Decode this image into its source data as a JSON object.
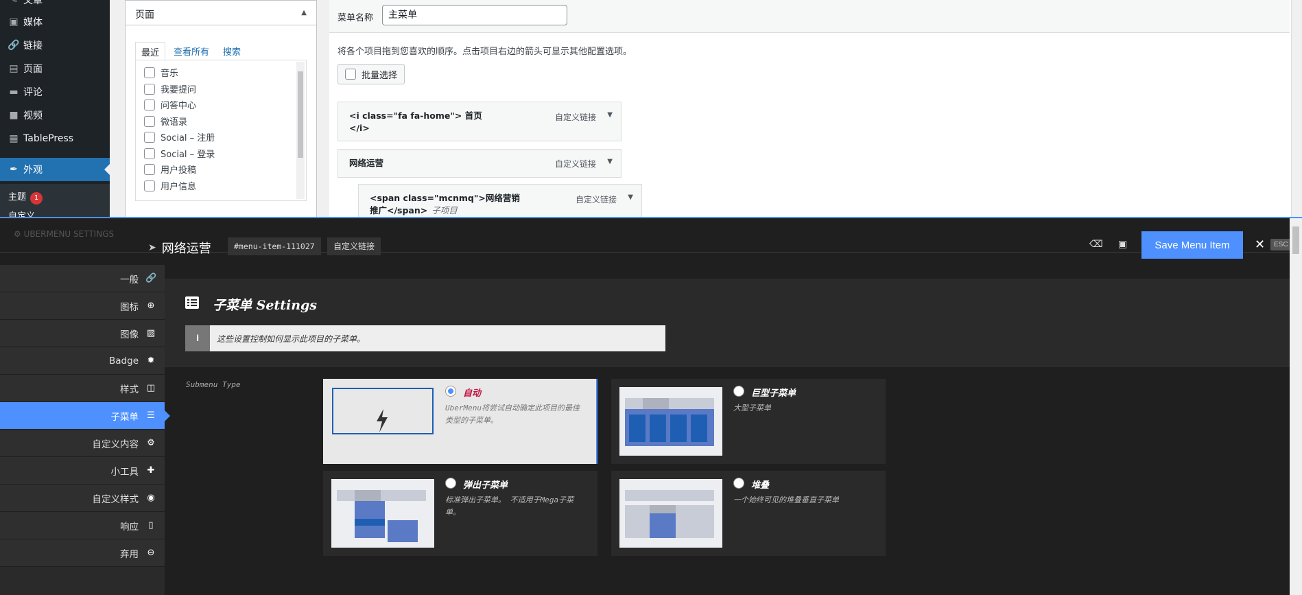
{
  "wp": {
    "sidebar": [
      {
        "icon": "✎",
        "label": "文章"
      },
      {
        "icon": "▣",
        "label": "媒体"
      },
      {
        "icon": "🔗",
        "label": "链接"
      },
      {
        "icon": "▤",
        "label": "页面"
      },
      {
        "icon": "▬",
        "label": "评论"
      },
      {
        "icon": "■",
        "label": "视频"
      },
      {
        "icon": "▦",
        "label": "TablePress"
      },
      {
        "icon": "✒",
        "label": "外观"
      }
    ],
    "submenu": {
      "theme_label": "主题",
      "theme_badge": "1",
      "customize_label": "自定义"
    },
    "pages_box": {
      "title": "页面",
      "tabs": [
        "最近",
        "查看所有",
        "搜索"
      ],
      "items": [
        "音乐",
        "我要提问",
        "问答中心",
        "微语录",
        "Social – 注册",
        "Social – 登录",
        "用户投稿",
        "用户信息"
      ]
    },
    "menu": {
      "name_label": "菜单名称",
      "name_value": "主菜单",
      "instructions": "将各个项目拖到您喜欢的顺序。点击项目右边的箭头可显示其他配置选项。",
      "bulk_select": "批量选择",
      "items": [
        {
          "title_l1": "<i class=\"fa fa-home\"> 首页",
          "title_l2": "</i>",
          "type": "自定义链接"
        },
        {
          "title_l1": "网络运营",
          "title_l2": "",
          "type": "自定义链接"
        },
        {
          "title_l1": "<span class=\"mcnmq\">网络营销",
          "title_l2": "推广</span>",
          "sub": "子项目",
          "type": "自定义链接"
        }
      ]
    }
  },
  "uber": {
    "brand": "UBERMENU SETTINGS",
    "item_title": "网络运营",
    "item_id": "#menu-item-111027",
    "item_type": "自定义链接",
    "save_label": "Save Menu Item",
    "esc_label": "ESC",
    "nav": [
      {
        "label": "一般",
        "icon": "🔗"
      },
      {
        "label": "图标",
        "icon": "⊕"
      },
      {
        "label": "图像",
        "icon": "▨"
      },
      {
        "label": "Badge",
        "icon": "✹"
      },
      {
        "label": "样式",
        "icon": "◫"
      },
      {
        "label": "子菜单",
        "icon": "☰"
      },
      {
        "label": "自定义内容",
        "icon": "⚙"
      },
      {
        "label": "小工具",
        "icon": "✚"
      },
      {
        "label": "自定义样式",
        "icon": "◉"
      },
      {
        "label": "响应",
        "icon": "▯"
      },
      {
        "label": "弃用",
        "icon": "⊖"
      }
    ],
    "active_nav_index": 5,
    "settings_title": "子菜单 Settings",
    "settings_info": "这些设置控制如何显示此项目的子菜单。",
    "submenu_type_label": "Submenu Type",
    "options": [
      {
        "name": "自动",
        "desc": "UberMenu将尝试自动确定此项目的最佳类型的子菜单。",
        "selected": true
      },
      {
        "name": "巨型子菜单",
        "desc": "大型子菜单",
        "selected": false
      },
      {
        "name": "弹出子菜单",
        "desc": "标准弹出子菜单。 不适用于Mega子菜单。",
        "selected": false
      },
      {
        "name": "堆叠",
        "desc": "一个始终可见的堆叠垂直子菜单",
        "selected": false
      }
    ],
    "colors": {
      "accent": "#4d90fe",
      "dark": "#1f1f1f",
      "selected_name": "#c0133d",
      "thumb_blue": "#1e5fb4",
      "thumb_soft_blue": "#5b7ac6"
    }
  }
}
